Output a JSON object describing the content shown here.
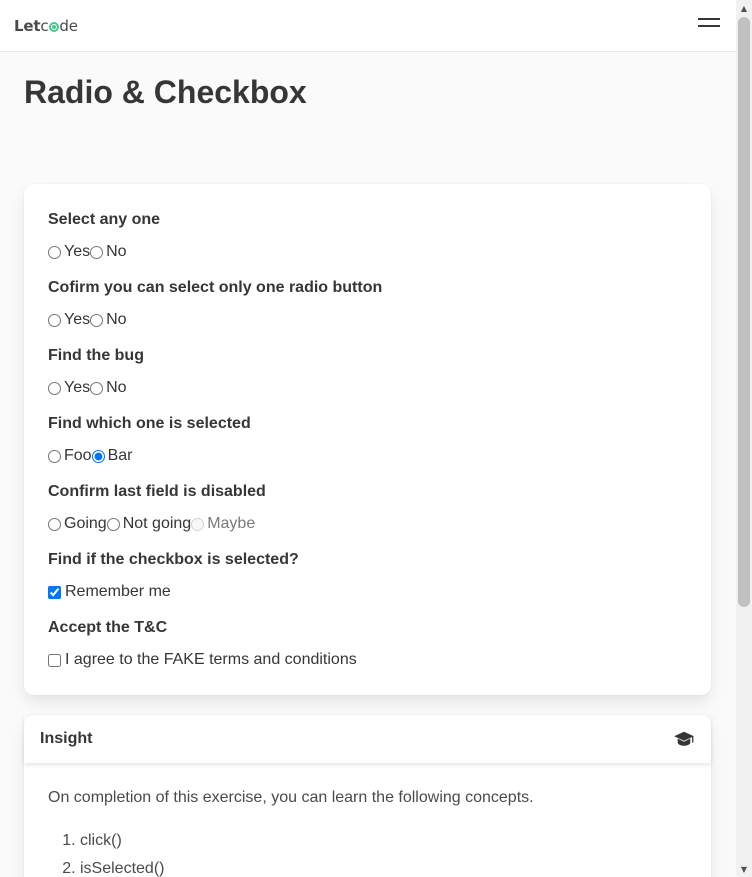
{
  "nav": {
    "logo_let": "Let",
    "logo_c": "c",
    "logo_de": "de"
  },
  "page": {
    "title": "Radio & Checkbox"
  },
  "fields": [
    {
      "label": "Select any one",
      "options": [
        "Yes",
        "No"
      ],
      "selected": null
    },
    {
      "label": "Cofirm you can select only one radio button",
      "options": [
        "Yes",
        "No"
      ],
      "selected": null
    },
    {
      "label": "Find the bug",
      "options": [
        "Yes",
        "No"
      ],
      "selected": null
    },
    {
      "label": "Find which one is selected",
      "options": [
        "Foo",
        "Bar"
      ],
      "selected": "Bar"
    },
    {
      "label": "Confirm last field is disabled",
      "options": [
        "Going",
        "Not going",
        "Maybe"
      ],
      "disabled": "Maybe"
    },
    {
      "label": "Find if the checkbox is selected?",
      "checkbox": "Remember me",
      "checked": true
    },
    {
      "label": "Accept the T&C",
      "checkbox": "I agree to the FAKE terms and conditions",
      "checked": false
    }
  ],
  "insight": {
    "title": "Insight",
    "icon": "graduation-cap-icon",
    "intro": "On completion of this exercise, you can learn the following concepts.",
    "items": [
      "click()",
      "isSelected()"
    ]
  },
  "colors": {
    "accent": "#0075ff",
    "logo_accent": "#48c78e"
  }
}
